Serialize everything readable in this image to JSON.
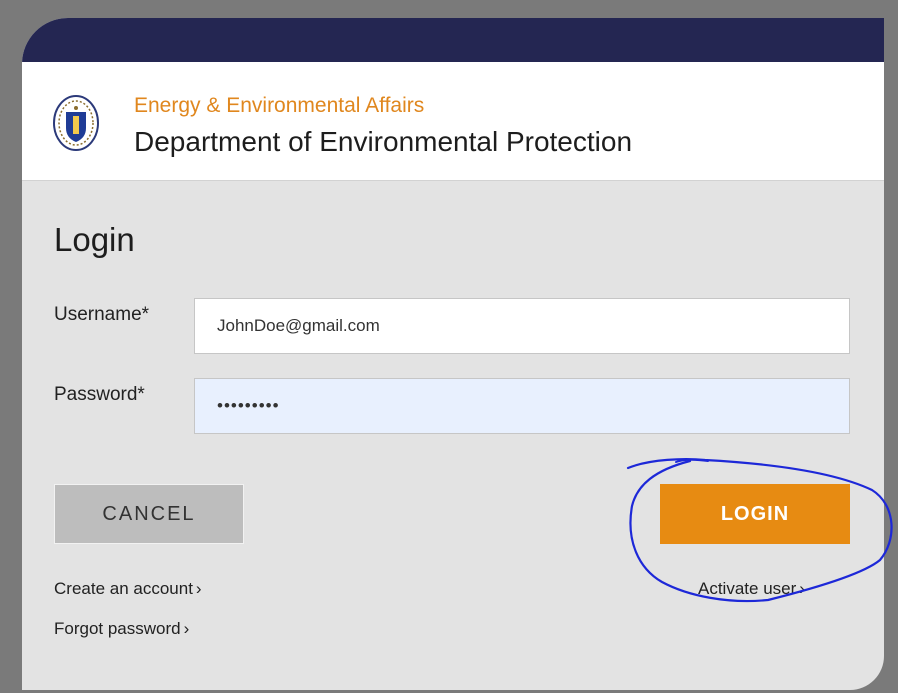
{
  "header": {
    "agency": "Energy & Environmental Affairs",
    "department": "Department of Environmental Protection",
    "seal_icon": "massachusetts-seal-icon"
  },
  "form": {
    "title": "Login",
    "username_label": "Username*",
    "username_value": "JohnDoe@gmail.com",
    "password_label": "Password*",
    "password_value": "password1"
  },
  "buttons": {
    "cancel": "CANCEL",
    "login": "LOGIN"
  },
  "links": {
    "create_account": "Create an account",
    "forgot_password": "Forgot password",
    "activate_user": "Activate user",
    "chevron": "›"
  },
  "colors": {
    "top_bar": "#242652",
    "agency_text": "#e0871e",
    "login_button": "#e78b12",
    "cancel_button": "#bdbdbd",
    "annotation_ink": "#1d28d8"
  }
}
